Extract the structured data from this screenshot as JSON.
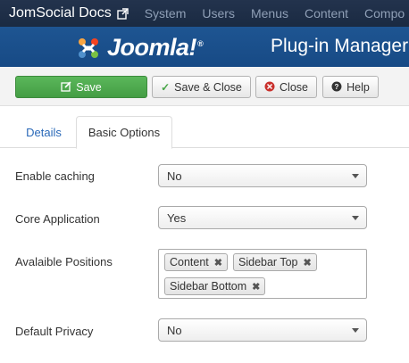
{
  "navbar": {
    "brand": "JomSocial Docs",
    "menu": [
      "System",
      "Users",
      "Menus",
      "Content",
      "Compo"
    ]
  },
  "header": {
    "logo_text": "Joomla!",
    "logo_mark": "®",
    "title": "Plug-in Manager:"
  },
  "toolbar": {
    "save": "Save",
    "save_close": "Save & Close",
    "close": "Close",
    "help": "Help"
  },
  "tabs": {
    "details": "Details",
    "basic_options": "Basic Options",
    "active": "basic_options"
  },
  "form": {
    "enable_caching": {
      "label": "Enable caching",
      "value": "No"
    },
    "core_application": {
      "label": "Core Application",
      "value": "Yes"
    },
    "available_positions": {
      "label": "Avalaible Positions",
      "chips": [
        "Content",
        "Sidebar Top",
        "Sidebar Bottom"
      ]
    },
    "default_privacy": {
      "label": "Default Privacy",
      "value": "No"
    }
  },
  "colors": {
    "navbar": "#1a2a42",
    "header": "#174a85",
    "save_green": "#46a546",
    "tab_link": "#2a69b8"
  }
}
